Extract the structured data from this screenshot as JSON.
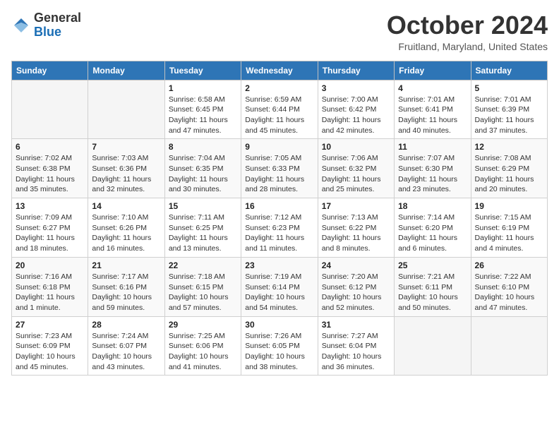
{
  "header": {
    "logo": {
      "line1": "General",
      "line2": "Blue"
    },
    "title": "October 2024",
    "location": "Fruitland, Maryland, United States"
  },
  "days_of_week": [
    "Sunday",
    "Monday",
    "Tuesday",
    "Wednesday",
    "Thursday",
    "Friday",
    "Saturday"
  ],
  "weeks": [
    [
      {
        "day": "",
        "empty": true
      },
      {
        "day": "",
        "empty": true
      },
      {
        "day": "1",
        "sunrise": "Sunrise: 6:58 AM",
        "sunset": "Sunset: 6:45 PM",
        "daylight": "Daylight: 11 hours and 47 minutes."
      },
      {
        "day": "2",
        "sunrise": "Sunrise: 6:59 AM",
        "sunset": "Sunset: 6:44 PM",
        "daylight": "Daylight: 11 hours and 45 minutes."
      },
      {
        "day": "3",
        "sunrise": "Sunrise: 7:00 AM",
        "sunset": "Sunset: 6:42 PM",
        "daylight": "Daylight: 11 hours and 42 minutes."
      },
      {
        "day": "4",
        "sunrise": "Sunrise: 7:01 AM",
        "sunset": "Sunset: 6:41 PM",
        "daylight": "Daylight: 11 hours and 40 minutes."
      },
      {
        "day": "5",
        "sunrise": "Sunrise: 7:01 AM",
        "sunset": "Sunset: 6:39 PM",
        "daylight": "Daylight: 11 hours and 37 minutes."
      }
    ],
    [
      {
        "day": "6",
        "sunrise": "Sunrise: 7:02 AM",
        "sunset": "Sunset: 6:38 PM",
        "daylight": "Daylight: 11 hours and 35 minutes."
      },
      {
        "day": "7",
        "sunrise": "Sunrise: 7:03 AM",
        "sunset": "Sunset: 6:36 PM",
        "daylight": "Daylight: 11 hours and 32 minutes."
      },
      {
        "day": "8",
        "sunrise": "Sunrise: 7:04 AM",
        "sunset": "Sunset: 6:35 PM",
        "daylight": "Daylight: 11 hours and 30 minutes."
      },
      {
        "day": "9",
        "sunrise": "Sunrise: 7:05 AM",
        "sunset": "Sunset: 6:33 PM",
        "daylight": "Daylight: 11 hours and 28 minutes."
      },
      {
        "day": "10",
        "sunrise": "Sunrise: 7:06 AM",
        "sunset": "Sunset: 6:32 PM",
        "daylight": "Daylight: 11 hours and 25 minutes."
      },
      {
        "day": "11",
        "sunrise": "Sunrise: 7:07 AM",
        "sunset": "Sunset: 6:30 PM",
        "daylight": "Daylight: 11 hours and 23 minutes."
      },
      {
        "day": "12",
        "sunrise": "Sunrise: 7:08 AM",
        "sunset": "Sunset: 6:29 PM",
        "daylight": "Daylight: 11 hours and 20 minutes."
      }
    ],
    [
      {
        "day": "13",
        "sunrise": "Sunrise: 7:09 AM",
        "sunset": "Sunset: 6:27 PM",
        "daylight": "Daylight: 11 hours and 18 minutes."
      },
      {
        "day": "14",
        "sunrise": "Sunrise: 7:10 AM",
        "sunset": "Sunset: 6:26 PM",
        "daylight": "Daylight: 11 hours and 16 minutes."
      },
      {
        "day": "15",
        "sunrise": "Sunrise: 7:11 AM",
        "sunset": "Sunset: 6:25 PM",
        "daylight": "Daylight: 11 hours and 13 minutes."
      },
      {
        "day": "16",
        "sunrise": "Sunrise: 7:12 AM",
        "sunset": "Sunset: 6:23 PM",
        "daylight": "Daylight: 11 hours and 11 minutes."
      },
      {
        "day": "17",
        "sunrise": "Sunrise: 7:13 AM",
        "sunset": "Sunset: 6:22 PM",
        "daylight": "Daylight: 11 hours and 8 minutes."
      },
      {
        "day": "18",
        "sunrise": "Sunrise: 7:14 AM",
        "sunset": "Sunset: 6:20 PM",
        "daylight": "Daylight: 11 hours and 6 minutes."
      },
      {
        "day": "19",
        "sunrise": "Sunrise: 7:15 AM",
        "sunset": "Sunset: 6:19 PM",
        "daylight": "Daylight: 11 hours and 4 minutes."
      }
    ],
    [
      {
        "day": "20",
        "sunrise": "Sunrise: 7:16 AM",
        "sunset": "Sunset: 6:18 PM",
        "daylight": "Daylight: 11 hours and 1 minute."
      },
      {
        "day": "21",
        "sunrise": "Sunrise: 7:17 AM",
        "sunset": "Sunset: 6:16 PM",
        "daylight": "Daylight: 10 hours and 59 minutes."
      },
      {
        "day": "22",
        "sunrise": "Sunrise: 7:18 AM",
        "sunset": "Sunset: 6:15 PM",
        "daylight": "Daylight: 10 hours and 57 minutes."
      },
      {
        "day": "23",
        "sunrise": "Sunrise: 7:19 AM",
        "sunset": "Sunset: 6:14 PM",
        "daylight": "Daylight: 10 hours and 54 minutes."
      },
      {
        "day": "24",
        "sunrise": "Sunrise: 7:20 AM",
        "sunset": "Sunset: 6:12 PM",
        "daylight": "Daylight: 10 hours and 52 minutes."
      },
      {
        "day": "25",
        "sunrise": "Sunrise: 7:21 AM",
        "sunset": "Sunset: 6:11 PM",
        "daylight": "Daylight: 10 hours and 50 minutes."
      },
      {
        "day": "26",
        "sunrise": "Sunrise: 7:22 AM",
        "sunset": "Sunset: 6:10 PM",
        "daylight": "Daylight: 10 hours and 47 minutes."
      }
    ],
    [
      {
        "day": "27",
        "sunrise": "Sunrise: 7:23 AM",
        "sunset": "Sunset: 6:09 PM",
        "daylight": "Daylight: 10 hours and 45 minutes."
      },
      {
        "day": "28",
        "sunrise": "Sunrise: 7:24 AM",
        "sunset": "Sunset: 6:07 PM",
        "daylight": "Daylight: 10 hours and 43 minutes."
      },
      {
        "day": "29",
        "sunrise": "Sunrise: 7:25 AM",
        "sunset": "Sunset: 6:06 PM",
        "daylight": "Daylight: 10 hours and 41 minutes."
      },
      {
        "day": "30",
        "sunrise": "Sunrise: 7:26 AM",
        "sunset": "Sunset: 6:05 PM",
        "daylight": "Daylight: 10 hours and 38 minutes."
      },
      {
        "day": "31",
        "sunrise": "Sunrise: 7:27 AM",
        "sunset": "Sunset: 6:04 PM",
        "daylight": "Daylight: 10 hours and 36 minutes."
      },
      {
        "day": "",
        "empty": true
      },
      {
        "day": "",
        "empty": true
      }
    ]
  ]
}
